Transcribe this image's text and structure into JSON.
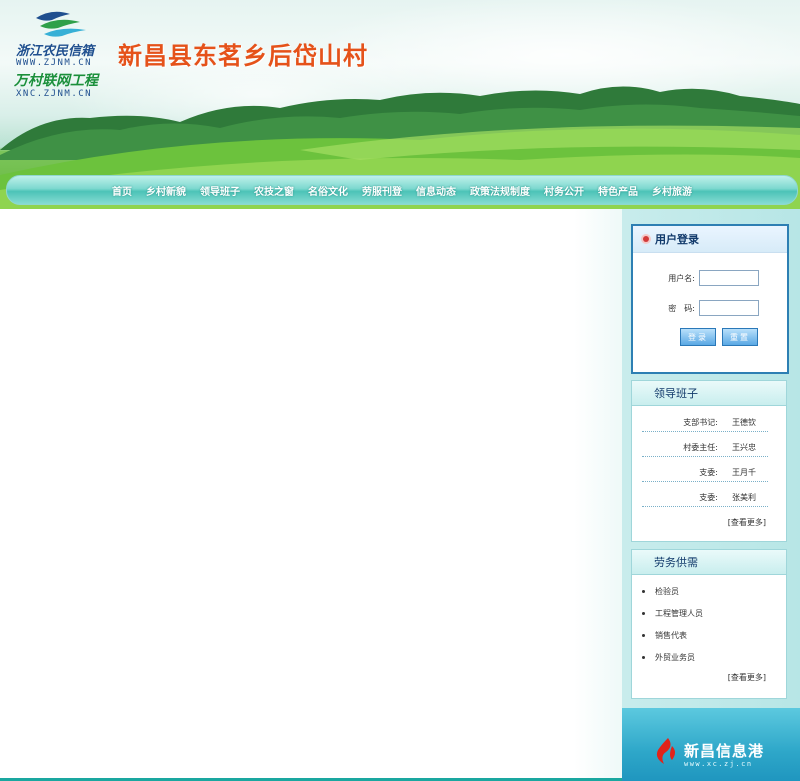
{
  "header": {
    "logo_line1": "浙江农民信箱",
    "logo_url1": "WWW.ZJNM.CN",
    "logo_line2": "万村联网工程",
    "logo_url2": "XNC.ZJNM.CN",
    "site_title": "新昌县东茗乡后岱山村"
  },
  "nav": {
    "items": [
      "首页",
      "乡村新貌",
      "领导班子",
      "农技之窗",
      "名俗文化",
      "劳服刊登",
      "信息动态",
      "政策法规制度",
      "村务公开",
      "特色产品",
      "乡村旅游"
    ]
  },
  "login": {
    "title": "用户登录",
    "username_label": "用户名:",
    "password_label": "密　码:",
    "username_value": "",
    "password_value": "",
    "login_button": "登录",
    "reset_button": "重置"
  },
  "leaders": {
    "title": "领导班子",
    "rows": [
      {
        "role": "支部书记:",
        "name": "王德钦"
      },
      {
        "role": "村委主任:",
        "name": "王兴忠"
      },
      {
        "role": "支委:",
        "name": "王月千"
      },
      {
        "role": "支委:",
        "name": "张美利"
      }
    ],
    "more": "[查看更多]"
  },
  "labor": {
    "title": "劳务供需",
    "items": [
      "检验员",
      "工程管理人员",
      "销售代表",
      "外贸业务员"
    ],
    "more": "[查看更多]"
  },
  "bottom_logo": {
    "text": "新昌信息港",
    "url": "www.xc.zj.cn"
  },
  "colors": {
    "title_orange": "#e5521a",
    "nav_teal": "#4cc3b7",
    "login_border": "#2d7fb3",
    "sidebar_bg": "#c8ecec"
  }
}
